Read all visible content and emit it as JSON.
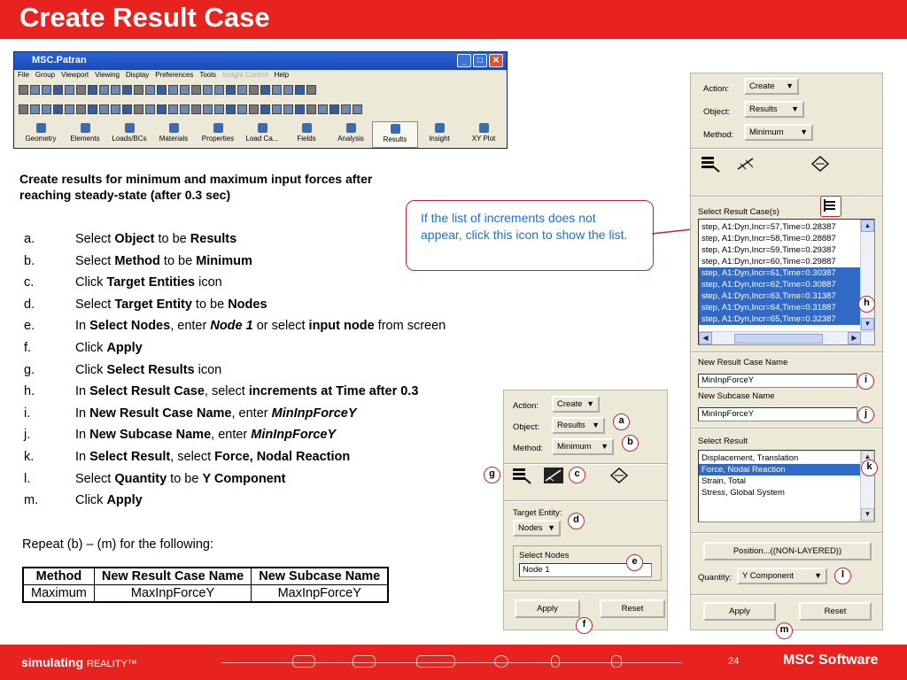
{
  "slide": {
    "title": "Create Result Case",
    "intro": "Create results for minimum and maximum input forces after reaching steady-state (after 0.3 sec)",
    "steps": [
      {
        "letter": "a.",
        "parts": [
          [
            "Select ",
            "n"
          ],
          [
            "Object",
            "b"
          ],
          [
            " to be ",
            "n"
          ],
          [
            "Results",
            "b"
          ]
        ]
      },
      {
        "letter": "b.",
        "parts": [
          [
            "Select ",
            "n"
          ],
          [
            "Method",
            "b"
          ],
          [
            " to be ",
            "n"
          ],
          [
            "Minimum",
            "b"
          ]
        ]
      },
      {
        "letter": "c.",
        "parts": [
          [
            "Click ",
            "n"
          ],
          [
            "Target Entities",
            "b"
          ],
          [
            " icon",
            "n"
          ]
        ]
      },
      {
        "letter": "d.",
        "parts": [
          [
            "Select ",
            "n"
          ],
          [
            "Target Entity",
            "b"
          ],
          [
            " to be ",
            "n"
          ],
          [
            "Nodes",
            "b"
          ]
        ]
      },
      {
        "letter": "e.",
        "parts": [
          [
            "In ",
            "n"
          ],
          [
            "Select Nodes",
            "b"
          ],
          [
            ", enter ",
            "n"
          ],
          [
            "Node 1",
            "bi"
          ],
          [
            " or select ",
            "n"
          ],
          [
            "input node",
            "b"
          ],
          [
            " from screen",
            "n"
          ]
        ]
      },
      {
        "letter": "f.",
        "parts": [
          [
            "Click ",
            "n"
          ],
          [
            "Apply",
            "b"
          ]
        ]
      },
      {
        "letter": "g.",
        "parts": [
          [
            "Click ",
            "n"
          ],
          [
            "Select Results",
            "b"
          ],
          [
            " icon",
            "n"
          ]
        ]
      },
      {
        "letter": "h.",
        "parts": [
          [
            "In ",
            "n"
          ],
          [
            "Select Result Case",
            "b"
          ],
          [
            ", select ",
            "n"
          ],
          [
            "increments at Time after 0.3",
            "b"
          ]
        ]
      },
      {
        "letter": "i.",
        "parts": [
          [
            "In ",
            "n"
          ],
          [
            "New Result Case Name",
            "b"
          ],
          [
            ", enter ",
            "n"
          ],
          [
            "MinInpForceY",
            "bi"
          ]
        ]
      },
      {
        "letter": "j.",
        "parts": [
          [
            "In ",
            "n"
          ],
          [
            "New Subcase Name",
            "b"
          ],
          [
            ", enter ",
            "n"
          ],
          [
            "MinInpForceY",
            "bi"
          ]
        ]
      },
      {
        "letter": "k.",
        "parts": [
          [
            "In ",
            "n"
          ],
          [
            "Select Result",
            "b"
          ],
          [
            ", select ",
            "n"
          ],
          [
            "Force, Nodal Reaction",
            "b"
          ]
        ]
      },
      {
        "letter": "l.",
        "parts": [
          [
            "Select ",
            "n"
          ],
          [
            "Quantity",
            "b"
          ],
          [
            " to be ",
            "n"
          ],
          [
            "Y Component",
            "b"
          ]
        ]
      },
      {
        "letter": "m.",
        "parts": [
          [
            "Click ",
            "n"
          ],
          [
            "Apply",
            "b"
          ]
        ]
      }
    ],
    "repeat": "Repeat (b) – (m) for the following:",
    "table": {
      "headers": [
        "Method",
        "New Result Case Name",
        "New Subcase Name"
      ],
      "rows": [
        [
          "Maximum",
          "MaxInpForceY",
          "MaxInpForceY"
        ]
      ]
    },
    "callout": "If the list of increments does not appear, click this icon to show the list."
  },
  "patran": {
    "title": "MSC.Patran",
    "menu": [
      "File",
      "Group",
      "Viewport",
      "Viewing",
      "Display",
      "Preferences",
      "Tools",
      "Insight Control",
      "Help"
    ],
    "apps": [
      "Geometry",
      "Elements",
      "Loads/BCs",
      "Materials",
      "Properties",
      "Load Ca...",
      "Fields",
      "Analysis",
      "Results",
      "Insight",
      "XY Plot"
    ],
    "selected_app": "Results"
  },
  "form_mid": {
    "action_label": "Action:",
    "action_value": "Create",
    "object_label": "Object:",
    "object_value": "Results",
    "method_label": "Method:",
    "method_value": "Minimum",
    "target_label": "Target Entity:",
    "target_value": "Nodes",
    "select_nodes_label": "Select Nodes",
    "select_nodes_value": "Node 1",
    "apply": "Apply",
    "reset": "Reset"
  },
  "form_right": {
    "action_label": "Action:",
    "action_value": "Create",
    "object_label": "Object:",
    "object_value": "Results",
    "method_label": "Method:",
    "method_value": "Minimum",
    "select_case_label": "Select Result Case(s)",
    "cases": [
      {
        "text": "step, A1:Dyn,Incr=57,Time=0.28387",
        "selected": false
      },
      {
        "text": "step, A1:Dyn,Incr=58,Time=0.28887",
        "selected": false
      },
      {
        "text": "step, A1:Dyn,Incr=59,Time=0.29387",
        "selected": false
      },
      {
        "text": "step, A1:Dyn,Incr=60,Time=0.29887",
        "selected": false
      },
      {
        "text": "step, A1:Dyn,Incr=61,Time=0.30387",
        "selected": true
      },
      {
        "text": "step, A1:Dyn,Incr=62,Time=0.30887",
        "selected": true
      },
      {
        "text": "step, A1:Dyn,Incr=63,Time=0.31387",
        "selected": true
      },
      {
        "text": "step, A1:Dyn,Incr=64,Time=0.31887",
        "selected": true
      },
      {
        "text": "step, A1:Dyn,Incr=65,Time=0.32387",
        "selected": true
      }
    ],
    "new_case_label": "New Result Case Name",
    "new_case_value": "MinInpForceY",
    "new_subcase_label": "New Subcase Name",
    "new_subcase_value": "MinInpForceY",
    "select_result_label": "Select Result",
    "results": [
      {
        "text": "Displacement, Translation",
        "selected": false
      },
      {
        "text": "Force, Nodal Reaction",
        "selected": true
      },
      {
        "text": "Strain, Total",
        "selected": false
      },
      {
        "text": "Stress, Global System",
        "selected": false
      }
    ],
    "position_button": "Position...((NON-LAYERED))",
    "quantity_label": "Quantity:",
    "quantity_value": "Y Component",
    "apply": "Apply",
    "reset": "Reset"
  },
  "markers": {
    "a": "a",
    "b": "b",
    "c": "c",
    "d": "d",
    "e": "e",
    "f": "f",
    "g": "g",
    "h": "h",
    "i": "i",
    "j": "j",
    "k": "k",
    "l": "l",
    "m": "m"
  },
  "footer": {
    "brand": "simulating",
    "brand_sub": "REALITY™",
    "page": "24",
    "logo": "MSC Software"
  }
}
